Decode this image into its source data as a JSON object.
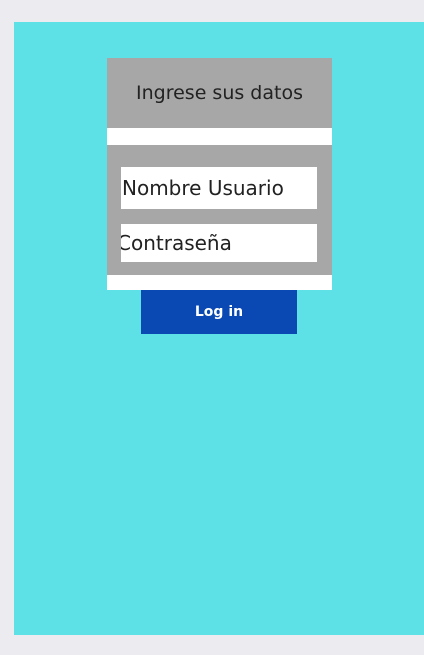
{
  "login_card": {
    "header_text": "Ingrese sus datos",
    "username_placeholder": "Nombre Usuario",
    "password_placeholder": "Contraseña"
  },
  "login_button": {
    "label": "Log in"
  },
  "colors": {
    "background": "#5ee1e6",
    "card_gray": "#a7a7a7",
    "button": "#0a49b3"
  }
}
